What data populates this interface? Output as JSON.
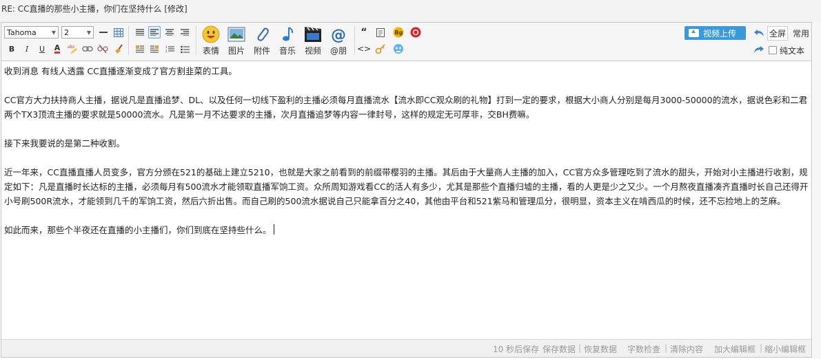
{
  "title": "RE: CC直播的那些小主播，你们在坚持什么 [修改]",
  "toolbar": {
    "font_family": "Tahoma",
    "font_size": "2",
    "buttons": {
      "bold": "B",
      "italic": "I",
      "underline": "U",
      "font_color": "A"
    },
    "media": [
      {
        "label": "表情",
        "icon": "emoticon-icon"
      },
      {
        "label": "图片",
        "icon": "image-icon"
      },
      {
        "label": "附件",
        "icon": "attachment-icon"
      },
      {
        "label": "音乐",
        "icon": "music-icon"
      },
      {
        "label": "视频",
        "icon": "video-icon"
      },
      {
        "label": "@朋",
        "icon": "at-icon"
      }
    ],
    "video_upload": "视频上传",
    "fullscreen": "全屏",
    "common": "常用",
    "plain_text": "纯文本"
  },
  "content": {
    "paragraphs": [
      "收到消息    有线人透露    CC直播逐渐变成了官方割韭菜的工具。",
      "",
      "CC官方大力扶持商人主播，据说凡是直播追梦、DL、以及任何一切线下盈利的主播必须每月直播流水【流水即CC观众刷的礼物】打到一定的要求，根据大小商人分别是每月3000-50000的流水，据说色彩和二君两个TX3顶流主播的要求就是50000流水。凡是第一月不达要求的主播，次月直播追梦等内容一律封号，这样的规定无可厚非，交BH费嘛。",
      "",
      "接下来我要说的是第二种收割。",
      "",
      "近一年来，CC直播直播人员变多，官方分颁在521的基础上建立5210，也就是大家之前看到的前缀带樱羽的主播。其后由于大量商人主播的加入，CC官方众多管理吃到了流水的甜头，开始对小主播进行收割，规定如下：凡是直播时长达标的主播，必须每月有500流水才能领取直播军饷工资。众所周知游戏看CC的活人有多少，尤其是那些个直播归墟的主播，看的人更是少之又少。一个月熬夜直播凑齐直播时长自己还得开小号刷500R流水，才能领到几千的军饷工资，然后六折出售。而自己刷的500流水据说自己只能拿百分之40，其他由平台和521紫马和管理瓜分，很明显，资本主义在啃西瓜的时候，还不忘捡地上的芝麻。",
      "",
      "如此而来，那些个半夜还在直播的小主播们，你们到底在坚持些什么。"
    ]
  },
  "status": {
    "autosave": "10 秒后保存",
    "save_data": "保存数据",
    "restore_data": "恢复数据",
    "word_check": "字数检查",
    "clear_content": "清除内容",
    "enlarge": "加大编辑框",
    "shrink": "缩小编辑框"
  }
}
